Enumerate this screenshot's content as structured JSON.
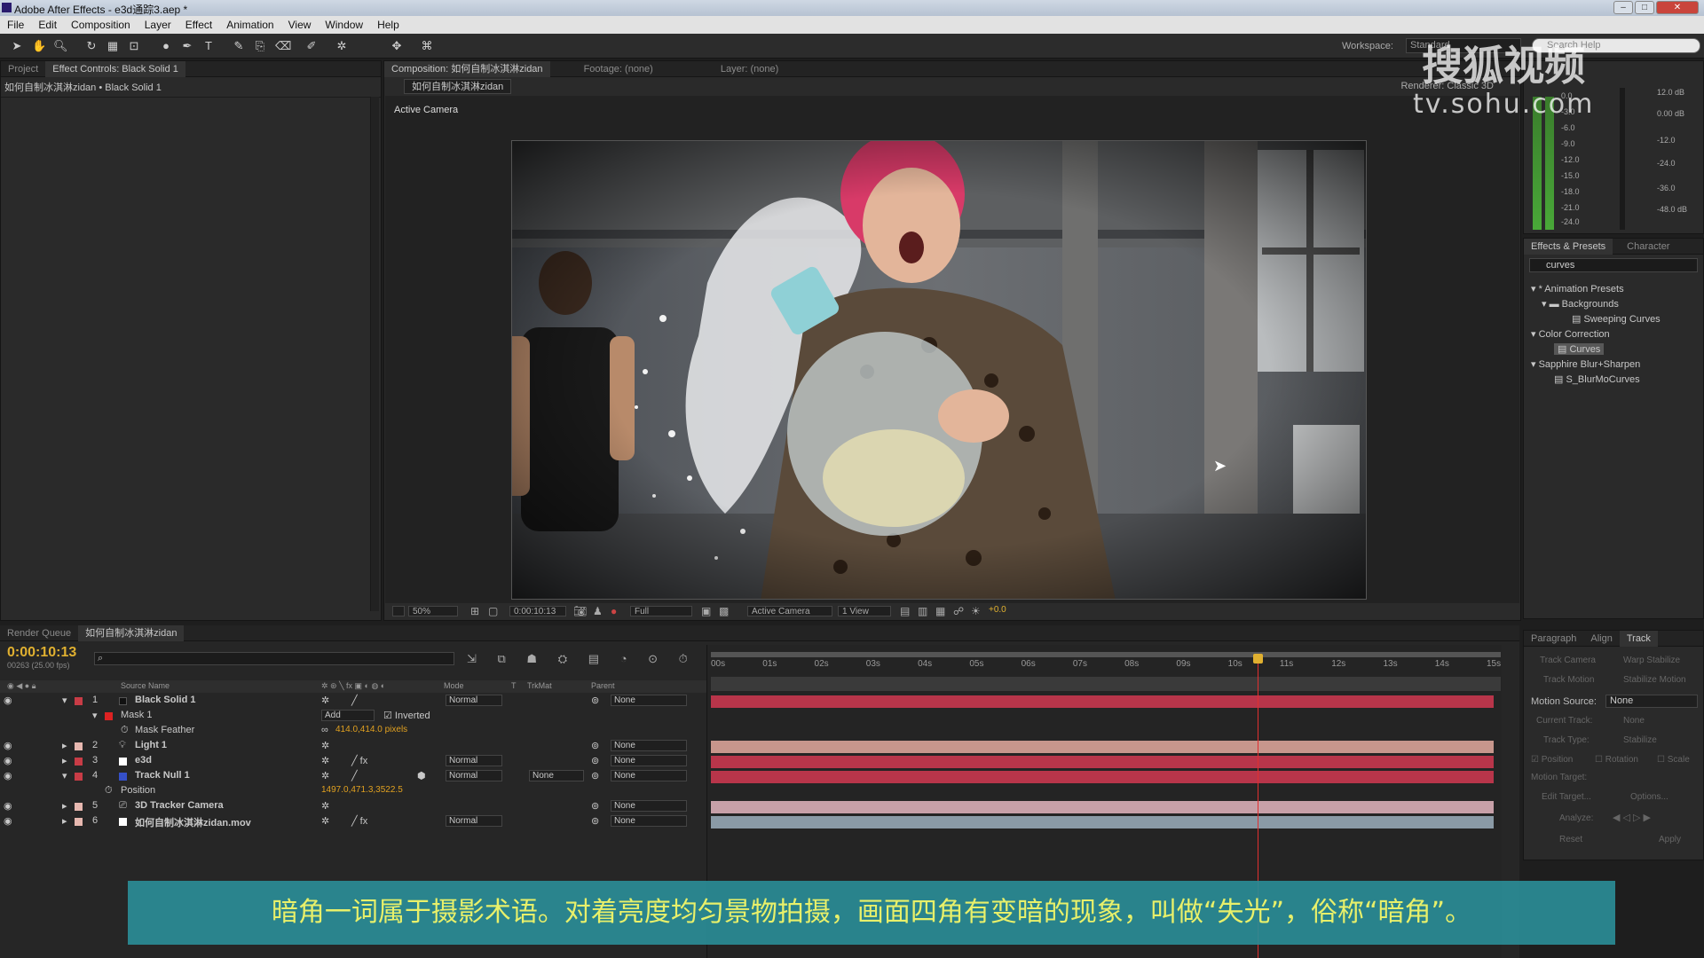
{
  "window": {
    "title": "Adobe After Effects - e3d通踪3.aep *"
  },
  "menu": [
    "File",
    "Edit",
    "Composition",
    "Layer",
    "Effect",
    "Animation",
    "View",
    "Window",
    "Help"
  ],
  "toolbar": {
    "workspace_label": "Workspace:",
    "workspace_value": "Standard",
    "search_placeholder": "Search Help"
  },
  "project_panel": {
    "tabs": [
      "Project",
      "Effect Controls: Black Solid 1"
    ],
    "breadcrumb": "如何自制冰淇淋zidan • Black Solid 1"
  },
  "composition_panel": {
    "tabs": [
      "Composition: 如何自制冰淇淋zidan",
      "Footage: (none)",
      "Layer: (none)"
    ],
    "comp_name": "如何自制冰淇淋zidan",
    "renderer_label": "Renderer:",
    "renderer_value": "Classic 3D",
    "view_label": "Active Camera",
    "viewbar": {
      "zoom": "50%",
      "time": "0:00:10:13",
      "resolution": "Full",
      "camera": "Active Camera",
      "views": "1 View",
      "exposure": "+0.0"
    }
  },
  "audio_panel": {
    "left_db": [
      "0.0",
      "-3.0",
      "-6.0",
      "-9.0",
      "-12.0",
      "-15.0",
      "-18.0",
      "-21.0",
      "-24.0"
    ],
    "right_db": [
      "12.0 dB",
      "0.00 dB",
      "-12.0",
      "-24.0",
      "-36.0",
      "-48.0 dB"
    ]
  },
  "effects_presets": {
    "tabs": [
      "Effects & Presets",
      "Character"
    ],
    "search_value": "curves",
    "tree": [
      {
        "label": "* Animation Presets",
        "level": 0,
        "expanded": true
      },
      {
        "label": "Backgrounds",
        "level": 1,
        "expanded": true
      },
      {
        "label": "Sweeping Curves",
        "level": 2
      },
      {
        "label": "Color Correction",
        "level": 0,
        "expanded": true
      },
      {
        "label": "Curves",
        "level": 2,
        "selected": true
      },
      {
        "label": "Sapphire Blur+Sharpen",
        "level": 0,
        "expanded": true
      },
      {
        "label": "S_BlurMoCurves",
        "level": 2
      }
    ]
  },
  "tracker_panel": {
    "tabs": [
      "Paragraph",
      "Align",
      "Track"
    ],
    "buttons": [
      "Track Camera",
      "Warp Stabilize",
      "Track Motion",
      "Stabilize Motion"
    ],
    "motion_source_label": "Motion Source:",
    "motion_source_value": "None",
    "current_track_label": "Current Track:",
    "current_track_value": "None",
    "track_type_label": "Track Type:",
    "track_type_value": "Stabilize",
    "checkboxes": [
      "Position",
      "Rotation",
      "Scale"
    ],
    "motion_target_label": "Motion Target:",
    "edit_target": "Edit Target...",
    "options": "Options...",
    "analyze_label": "Analyze:",
    "reset": "Reset",
    "apply": "Apply"
  },
  "timeline": {
    "tabs": [
      "Render Queue",
      "如何自制冰淇淋zidan"
    ],
    "current_time": "0:00:10:13",
    "frame_info": "00263 (25.00 fps)",
    "columns": {
      "source_name": "Source Name",
      "mode": "Mode",
      "t": "T",
      "trkmat": "TrkMat",
      "parent": "Parent"
    },
    "ruler": [
      "00s",
      "01s",
      "02s",
      "03s",
      "04s",
      "05s",
      "06s",
      "07s",
      "08s",
      "09s",
      "10s",
      "11s",
      "12s",
      "13s",
      "14s",
      "15s"
    ],
    "playhead_fraction": 0.698,
    "layers": [
      {
        "num": "1",
        "name": "Black Solid 1",
        "color": "#c83c46",
        "swatch": "#111111",
        "mode": "Normal",
        "parent": "None",
        "bar_color": "#b8354a"
      },
      {
        "sub": "Mask 1",
        "mask_mode": "Add",
        "inverted": "Inverted"
      },
      {
        "sub2": "Mask Feather",
        "value": "414.0,414.0 pixels"
      },
      {
        "num": "2",
        "name": "Light 1",
        "color": "#e7b8b0",
        "swatch": "",
        "mode": "",
        "parent": "None",
        "bar_color": "#c7968c"
      },
      {
        "num": "3",
        "name": "e3d",
        "color": "#c83c46",
        "swatch": "#ffffff",
        "mode": "Normal",
        "parent": "None",
        "bar_color": "#b8354a"
      },
      {
        "num": "4",
        "name": "Track Null 1",
        "color": "#c83c46",
        "swatch": "#3550c8",
        "mode": "Normal",
        "trkmat": "None",
        "parent": "None",
        "bar_color": "#b8354a"
      },
      {
        "sub2": "Position",
        "value": "1497.0,471.3,3522.5"
      },
      {
        "num": "5",
        "name": "3D Tracker Camera",
        "color": "#e7b8b0",
        "swatch": "",
        "mode": "",
        "parent": "None",
        "bar_color": "#c7a0a8"
      },
      {
        "num": "6",
        "name": "如何自制冰淇淋zidan.mov",
        "color": "#e7b8b0",
        "swatch": "#ffffff",
        "mode": "Normal",
        "parent": "None",
        "bar_color": "#8a9aa6"
      }
    ]
  },
  "subtitle": "暗角一词属于摄影术语。对着亮度均匀景物拍摄，画面四角有变暗的现象，叫做“失光”，俗称“暗角”。",
  "watermark": {
    "line1": "搜狐视频",
    "line2": "tv.sohu.com"
  }
}
